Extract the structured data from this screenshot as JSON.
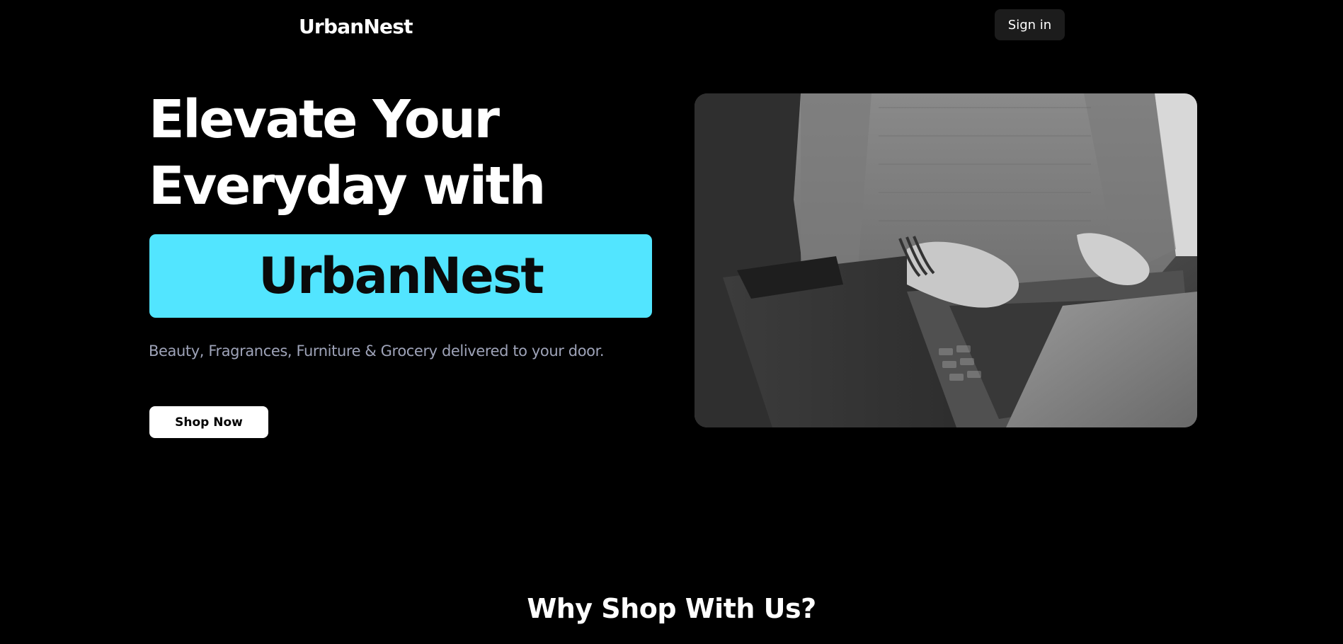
{
  "header": {
    "brand": "UrbanNest",
    "signin_label": "Sign in"
  },
  "hero": {
    "title_line1": "Elevate Your",
    "title_line2": "Everyday with",
    "highlight": "UrbanNest",
    "tagline": "Beauty, Fragrances, Furniture & Grocery delivered to your door.",
    "cta_label": "Shop Now",
    "image": "person-typing-on-laptop-photo"
  },
  "features": {
    "title": "Why Shop With Us?"
  },
  "colors": {
    "background": "#000000",
    "accent": "#52e5ff",
    "tagline": "#9ea3b8",
    "signin_bg": "#1c1c1c"
  }
}
